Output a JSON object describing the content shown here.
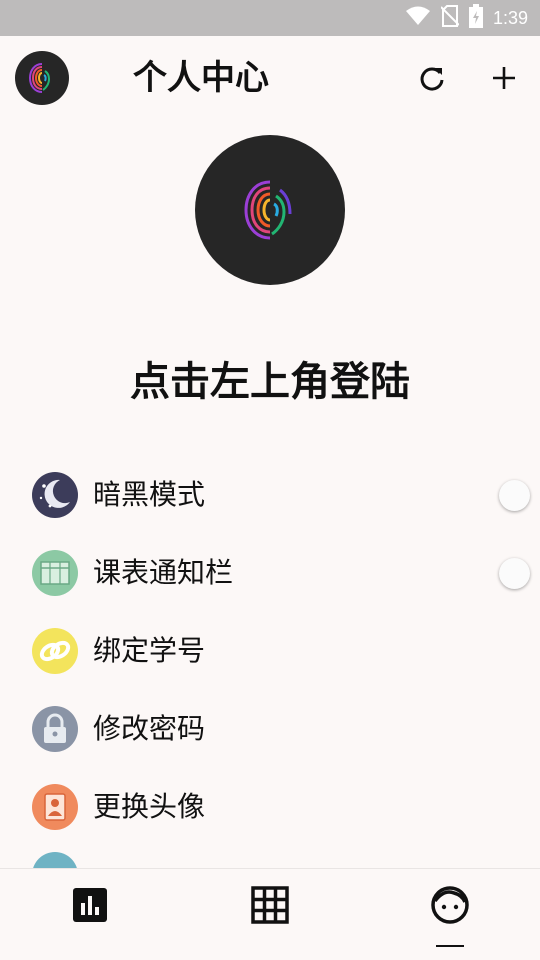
{
  "status_bar": {
    "time": "1:39",
    "icons": [
      "wifi-icon",
      "no-sim-icon",
      "battery-charging-icon"
    ]
  },
  "app_bar": {
    "title": "个人中心",
    "actions": [
      "refresh-icon",
      "add-icon"
    ]
  },
  "profile": {
    "login_prompt": "点击左上角登陆"
  },
  "menu": {
    "items": [
      {
        "label": "暗黑模式",
        "icon": "moon-night-icon",
        "icon_color": "#3c3c5a",
        "toggle": false
      },
      {
        "label": "课表通知栏",
        "icon": "timetable-icon",
        "icon_color": "#8cc9a4",
        "toggle": false
      },
      {
        "label": "绑定学号",
        "icon": "link-icon",
        "icon_color": "#f3e45c"
      },
      {
        "label": "修改密码",
        "icon": "lock-icon",
        "icon_color": "#8a94a6"
      },
      {
        "label": "更换头像",
        "icon": "portrait-icon",
        "icon_color": "#f08a5d"
      }
    ]
  },
  "bottom_nav": {
    "items": [
      "chart-icon",
      "grid-icon",
      "face-icon"
    ],
    "selected": 2
  }
}
